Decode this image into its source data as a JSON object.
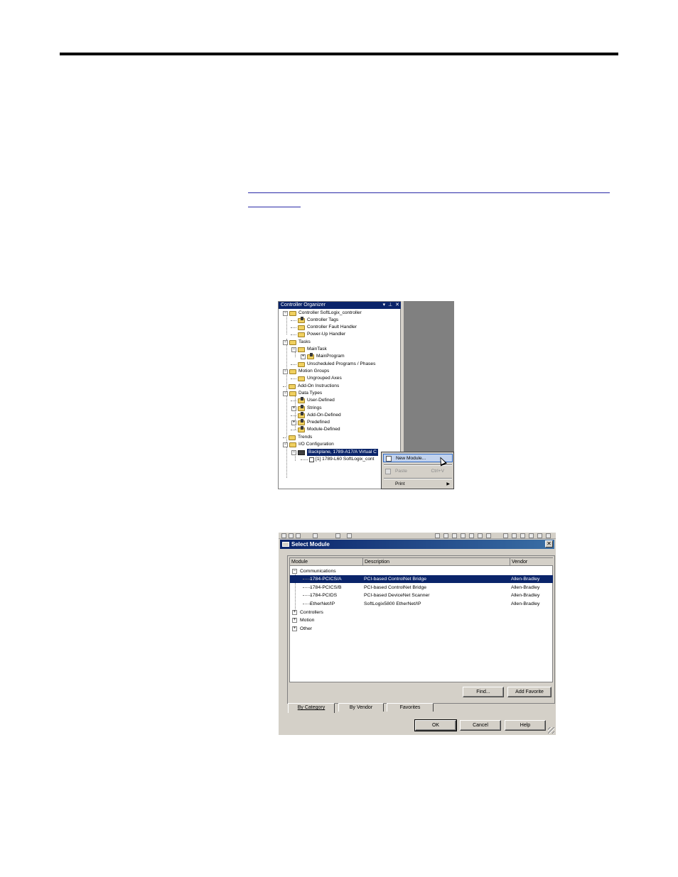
{
  "organizer": {
    "title": "Controller Organizer",
    "title_controls": "▾ ⊥ ✕",
    "tree": [
      {
        "label": "Controller SoftLogix_controller",
        "expanded": true
      },
      {
        "label": "Controller Tags"
      },
      {
        "label": "Controller Fault Handler"
      },
      {
        "label": "Power-Up Handler"
      },
      {
        "label": "Tasks",
        "expanded": true
      },
      {
        "label": "MainTask",
        "expanded": true
      },
      {
        "label": "MainProgram",
        "expanded": false
      },
      {
        "label": "Unscheduled Programs / Phases"
      },
      {
        "label": "Motion Groups",
        "expanded": true
      },
      {
        "label": "Ungrouped Axes"
      },
      {
        "label": "Add-On Instructions"
      },
      {
        "label": "Data Types",
        "expanded": true
      },
      {
        "label": "User-Defined"
      },
      {
        "label": "Strings",
        "expanded": false
      },
      {
        "label": "Add-On-Defined"
      },
      {
        "label": "Predefined",
        "expanded": false
      },
      {
        "label": "Module-Defined"
      },
      {
        "label": "Trends"
      },
      {
        "label": "I/O Configuration",
        "expanded": true
      },
      {
        "label": "Backplane, 1789-A17/A Virtual C",
        "selected": true
      },
      {
        "label": "[1] 1789-L60 SoftLogix_cont"
      }
    ],
    "context_menu": [
      {
        "label": "New Module...",
        "highlighted": true
      },
      {
        "label": "Paste",
        "shortcut": "Ctrl+V",
        "disabled": true
      },
      {
        "label": "Print",
        "submenu": true
      }
    ]
  },
  "select_module": {
    "title": "Select Module",
    "close_glyph": "✕",
    "columns": [
      "Module",
      "Description",
      "Vendor"
    ],
    "categories": [
      {
        "label": "Communications",
        "expanded": true
      },
      {
        "label": "Controllers",
        "expanded": false
      },
      {
        "label": "Motion",
        "expanded": false
      },
      {
        "label": "Other",
        "expanded": false
      }
    ],
    "rows": [
      {
        "module": "1784-PCICS/A",
        "description": "PCI-based ControlNet Bridge",
        "vendor": "Allen-Bradley",
        "selected": true
      },
      {
        "module": "1784-PCICS/B",
        "description": "PCI-based ControlNet Bridge",
        "vendor": "Allen-Bradley"
      },
      {
        "module": "1784-PCIDS",
        "description": "PCI-based DeviceNet Scanner",
        "vendor": "Allen-Bradley"
      },
      {
        "module": "EtherNet/IP",
        "description": "SoftLogix5800 EtherNet/IP",
        "vendor": "Allen-Bradley"
      }
    ],
    "find_button": "Find...",
    "add_favorite_button": "Add Favorite",
    "tabs": [
      "By Category",
      "By Vendor",
      "Favorites"
    ],
    "ok_button": "OK",
    "cancel_button": "Cancel",
    "help_button": "Help",
    "selection_color": "#0a246a"
  }
}
